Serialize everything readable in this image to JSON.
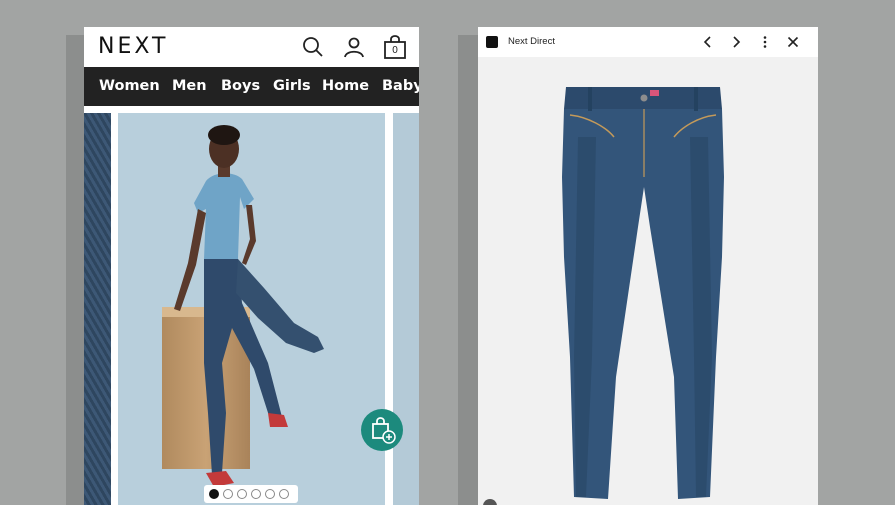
{
  "phone": {
    "brand": "NEXT",
    "bag_count": "0",
    "nav": [
      "Women",
      "Men",
      "Boys",
      "Girls",
      "Home",
      "Baby"
    ],
    "gallery": {
      "slide_count": 6,
      "active_slide": 1
    }
  },
  "viewer": {
    "title": "Next Direct"
  },
  "icons": {
    "search": "search-icon",
    "account": "account-icon",
    "bag": "shopping-bag-icon",
    "add_to_bag": "add-to-bag-icon",
    "back": "chevron-left-icon",
    "forward": "chevron-right-icon",
    "menu": "more-vertical-icon",
    "close": "close-icon"
  },
  "colors": {
    "nav_bg": "#222222",
    "add_to_bag_bg": "#1c8a7d",
    "backdrop": "#a2a4a3"
  }
}
